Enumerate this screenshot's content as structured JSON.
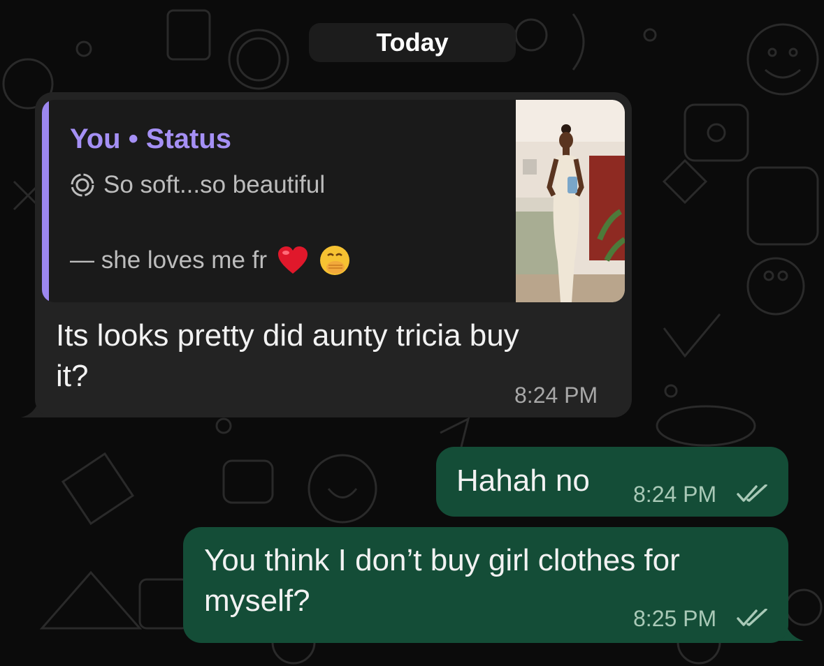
{
  "date_separator": "Today",
  "incoming": {
    "quote": {
      "author": "You • Status",
      "status_text": "So soft...so beautiful",
      "caption": "— she loves me fr",
      "emojis": [
        "heart-emoji",
        "face-with-hand-over-mouth-emoji"
      ]
    },
    "text": "Its looks pretty did aunty tricia buy it?",
    "line1": "Its looks pretty did aunty tricia buy",
    "line2": "it?",
    "time": "8:24 PM"
  },
  "outgoing": [
    {
      "line1": "Hahah no",
      "time": "8:24 PM",
      "status": "read-double-check-icon"
    },
    {
      "line1": "You think I don’t buy girl clothes for",
      "line2": "myself?",
      "time": "8:25 PM",
      "status": "read-double-check-icon"
    }
  ],
  "colors": {
    "background": "#0b0b0b",
    "incoming_bubble": "#232323",
    "outgoing_bubble": "#144d37",
    "quote_accent": "#9c87f0",
    "quote_author": "#a590f5"
  }
}
